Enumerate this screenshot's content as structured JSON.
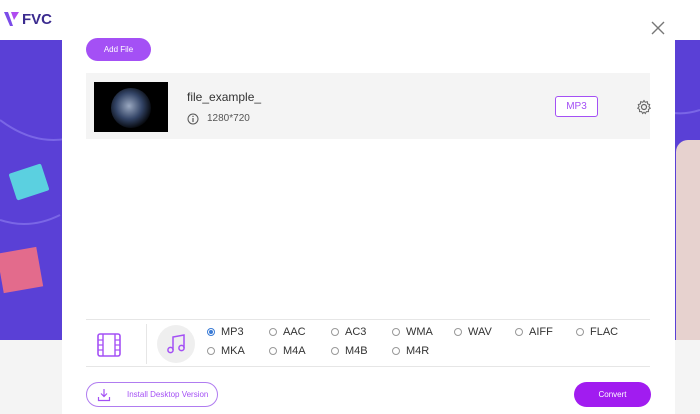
{
  "background": {
    "logo_text": "FVC"
  },
  "modal": {
    "add_file_label": "Add File",
    "file": {
      "name": "file_example_",
      "resolution": "1280*720",
      "format": "MP3"
    },
    "formats": {
      "row1": [
        "MP3",
        "AAC",
        "AC3",
        "WMA",
        "WAV",
        "AIFF",
        "FLAC"
      ],
      "row2": [
        "MKA",
        "M4A",
        "M4B",
        "M4R"
      ],
      "selected": "MP3"
    },
    "install_label": "Install Desktop Version",
    "convert_label": "Convert"
  },
  "colors": {
    "accent": "#a450f5",
    "convert": "#a11cf0",
    "hero": "#5a40d6"
  }
}
